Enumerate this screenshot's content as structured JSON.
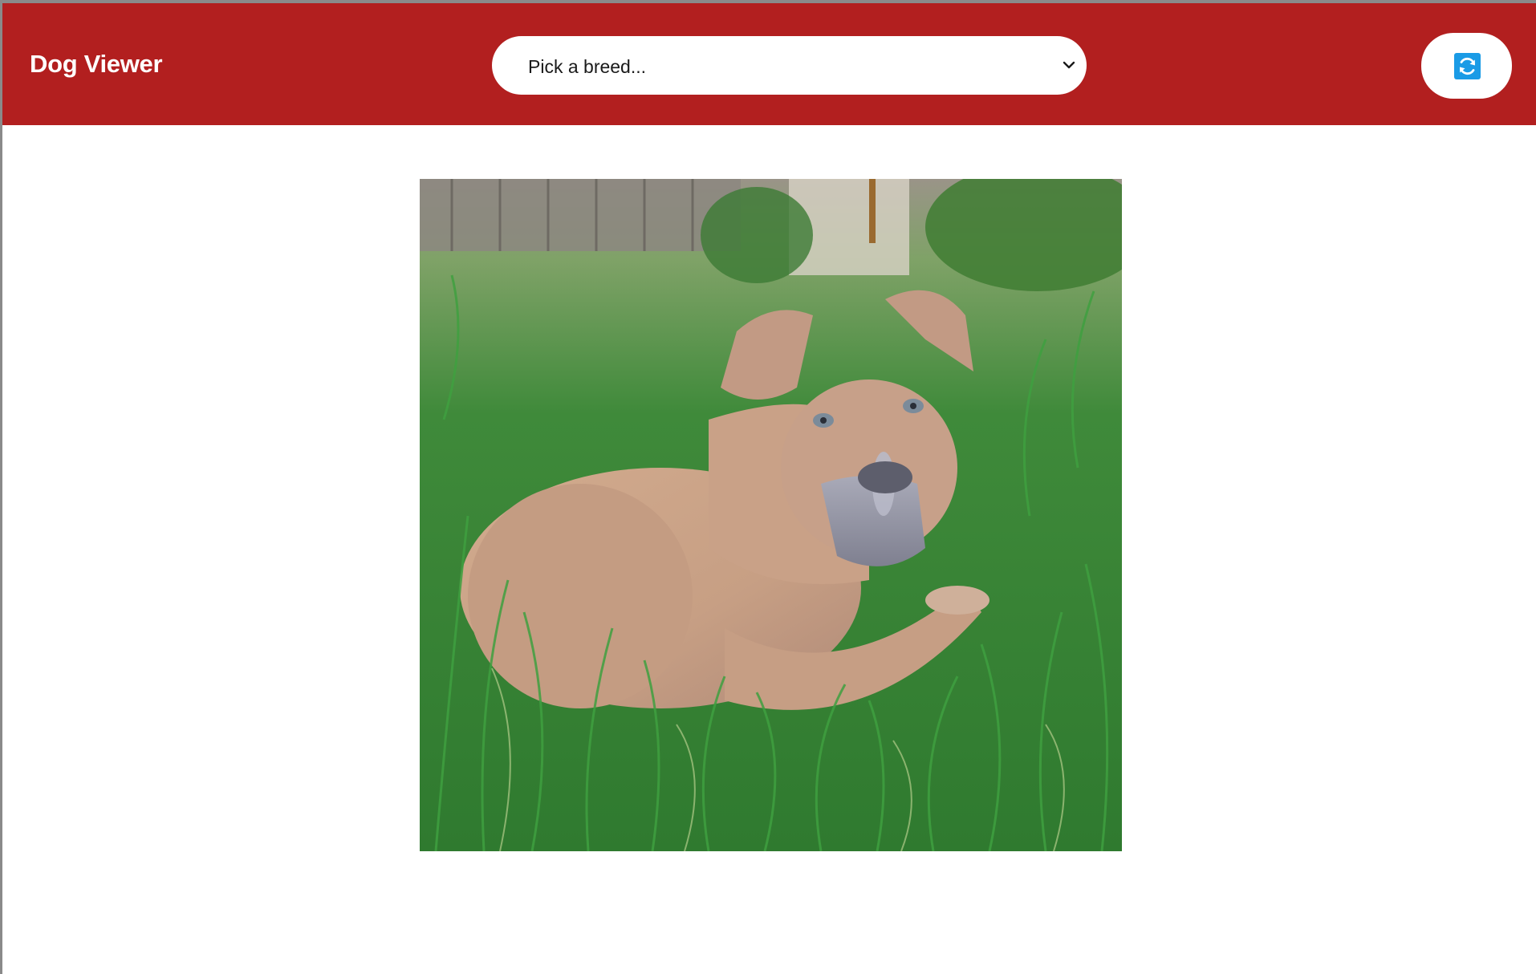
{
  "app": {
    "title": "Dog Viewer"
  },
  "breed_select": {
    "selected": "Pick a breed...",
    "icon": "chevron-down-icon"
  },
  "refresh": {
    "icon": "refresh-icon",
    "icon_color": "#1a9be6"
  },
  "colors": {
    "header": "#b21f1f",
    "background": "#ffffff"
  },
  "photo": {
    "subject": "dog-photo"
  }
}
